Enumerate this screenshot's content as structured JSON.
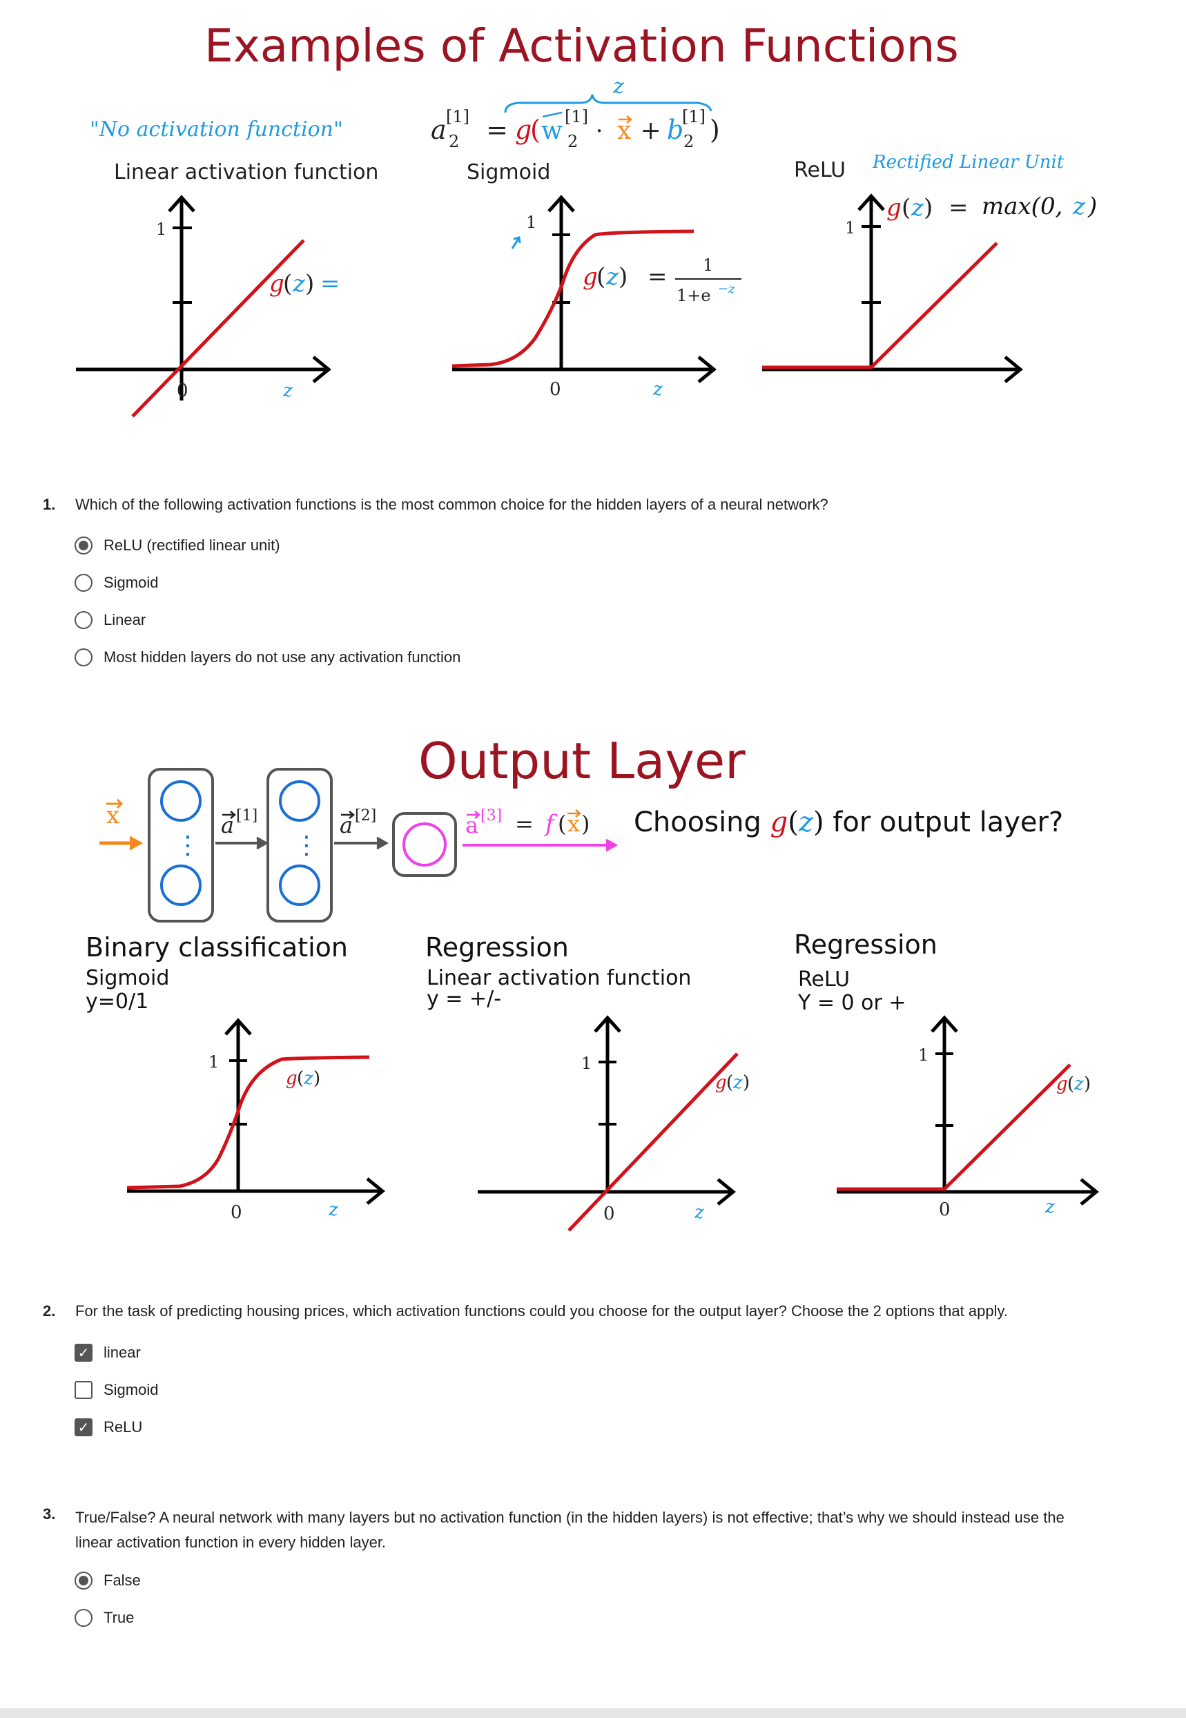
{
  "slide1": {
    "title": "Examples of Activation Functions",
    "formula": {
      "lhs_a": "a",
      "lhs_sup": "[1]",
      "lhs_sub": "2",
      "eq": " = ",
      "g": "g",
      "paren_open": "(",
      "w": "w",
      "w_sup": "[1]",
      "w_sub": "2",
      "dot": " · ",
      "x": "x",
      "plus": " + ",
      "b": "b",
      "b_sup": "[1]",
      "b_sub": "2",
      "paren_close": ")",
      "brace_label": "z"
    },
    "panels": [
      {
        "handwritten_note": "\"No activation function\"",
        "name": "Linear activation function",
        "y_tick": "1",
        "origin": "0",
        "x_label": "z",
        "formula_g": "g",
        "formula_z": "z",
        "formula_rest": "= z"
      },
      {
        "name": "Sigmoid",
        "y_tick": "1",
        "origin": "0",
        "x_label": "z",
        "formula_g": "g",
        "formula_z": "z",
        "formula_eq": "=",
        "frac_num": "1",
        "frac_den": "1+e",
        "frac_exp": "−z"
      },
      {
        "name": "ReLU",
        "handwritten_note": "Rectified Linear Unit",
        "y_tick": "1",
        "formula_g": "g",
        "formula_z": "z",
        "formula_eq": "=",
        "formula_hand_pre": "max(0,",
        "formula_hand_z": "z",
        "formula_hand_post": ")"
      }
    ]
  },
  "question1": {
    "number": "1.",
    "text": "Which of the following activation functions is the most common choice for the hidden layers of a neural network?",
    "options": [
      {
        "label": "ReLU (rectified linear unit)",
        "selected": true
      },
      {
        "label": "Sigmoid",
        "selected": false
      },
      {
        "label": "Linear",
        "selected": false
      },
      {
        "label": "Most hidden layers do not use any activation function",
        "selected": false
      }
    ]
  },
  "slide2": {
    "title": "Output Layer",
    "network": {
      "input": "x",
      "a1": "a",
      "a1_sup": "[1]",
      "a2": "a",
      "a2_sup": "[2]",
      "a3": "a",
      "a3_sup": "[3]",
      "eq": "=",
      "f": "f",
      "fx_x": "x",
      "node_dots": "⋮"
    },
    "question_pre": "Choosing ",
    "question_g": "g",
    "question_z": "z",
    "question_post": " for output layer?",
    "panels": [
      {
        "heading": "Binary classification",
        "sub1": "Sigmoid",
        "sub2": "y=0/1",
        "y_tick": "1",
        "origin": "0",
        "x_label": "z",
        "curve_g": "g",
        "curve_z": "z"
      },
      {
        "heading": "Regression",
        "sub1": "Linear activation function",
        "sub2": "y = +/-",
        "y_tick": "1",
        "origin": "0",
        "x_label": "z",
        "curve_g": "g",
        "curve_z": "z"
      },
      {
        "heading": "Regression",
        "sub1": "ReLU",
        "sub2": "Y = 0 or +",
        "y_tick": "1",
        "origin": "0",
        "x_label": "z",
        "curve_g": "g",
        "curve_z": "z"
      }
    ]
  },
  "question2": {
    "number": "2.",
    "text": "For the task of predicting housing prices, which activation functions could you choose for the output layer? Choose the 2 options that apply.",
    "options": [
      {
        "label": "linear",
        "checked": true
      },
      {
        "label": "Sigmoid",
        "checked": false
      },
      {
        "label": "ReLU",
        "checked": true
      }
    ],
    "check_glyph": "✓"
  },
  "question3": {
    "number": "3.",
    "text_line1": "True/False? A neural network with many layers but no activation function (in the hidden layers) is not effective; that’s why we should instead use the",
    "text_line2": "linear activation function in every hidden layer.",
    "options": [
      {
        "label": "False",
        "selected": true
      },
      {
        "label": "True",
        "selected": false
      }
    ]
  },
  "colors": {
    "title_red": "#9b1422",
    "curve_red": "#d0121b",
    "hand_blue": "#1e9be0",
    "orange": "#f28a1e",
    "magenta": "#f040e8",
    "node_blue": "#1a6fd6"
  }
}
